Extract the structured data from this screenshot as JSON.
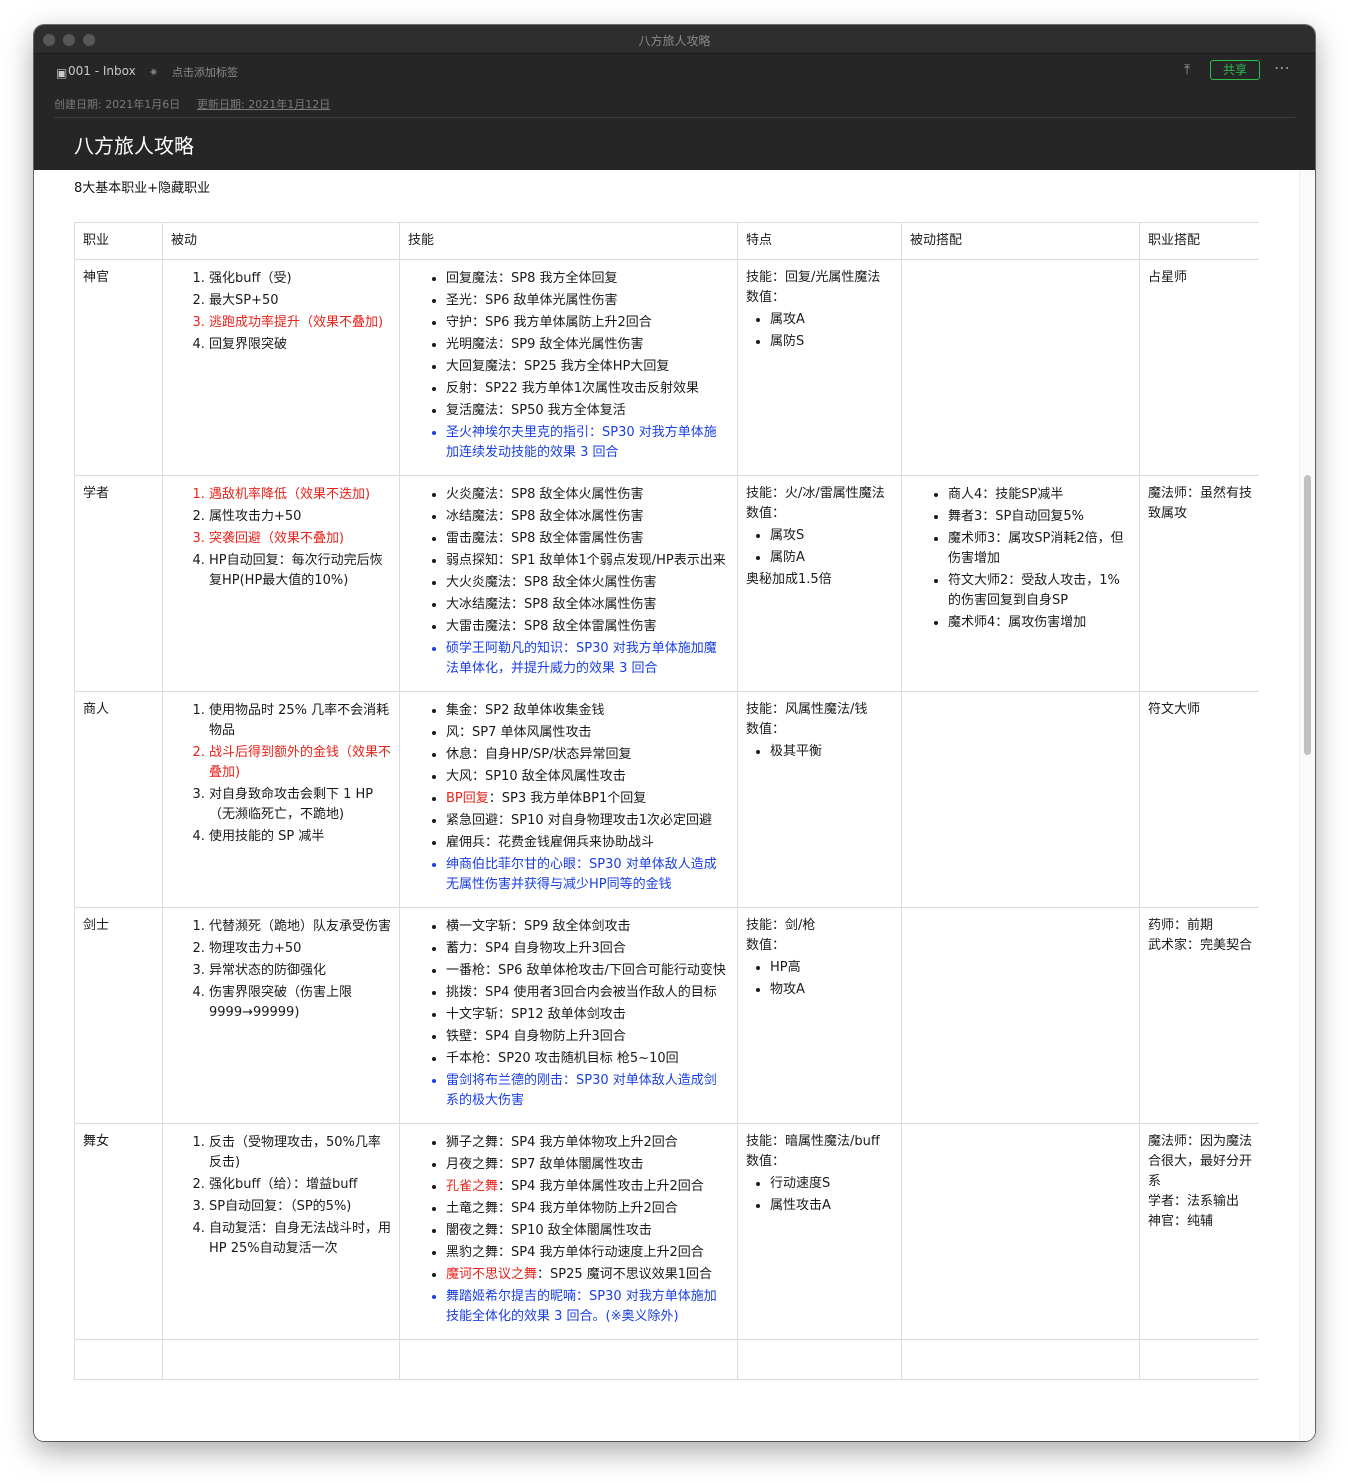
{
  "window": {
    "title": "八方旅人攻略"
  },
  "header": {
    "notebook": "001 - Inbox",
    "tag_placeholder": "点击添加标签",
    "share_label": "共享",
    "more_icon": "more-icon",
    "created": "创建日期: 2021年1月6日",
    "updated": "更新日期: 2021年1月12日"
  },
  "note": {
    "title": "八方旅人攻略",
    "subtitle": "8大基本职业+隐藏职业"
  },
  "colors": {
    "red": "#e8231b",
    "blue": "#1a3ee3",
    "share_green": "#2dbd4e"
  },
  "table": {
    "headers": [
      "职业",
      "被动",
      "技能",
      "特点",
      "被动搭配",
      "职业搭配"
    ],
    "rows": [
      {
        "job": "神官",
        "passives": [
          {
            "text": "强化buff（受)",
            "color": ""
          },
          {
            "text": "最大SP+50",
            "color": ""
          },
          {
            "text": "逃跑成功率提升（效果不叠加)",
            "color": "red"
          },
          {
            "text": "回复界限突破",
            "color": ""
          }
        ],
        "skills": [
          {
            "name": "回复魔法",
            "desc": "：SP8 我方全体回复",
            "color": ""
          },
          {
            "name": "圣光",
            "desc": "：SP6 敌单体光属性伤害",
            "color": ""
          },
          {
            "name": "守护",
            "desc": "：SP6 我方单体属防上升2回合",
            "color": ""
          },
          {
            "name": "光明魔法",
            "desc": "：SP9 敌全体光属性伤害",
            "color": ""
          },
          {
            "name": "大回复魔法",
            "desc": "：SP25 我方全体HP大回复",
            "color": ""
          },
          {
            "name": "反射",
            "desc": "：SP22 我方单体1次属性攻击反射效果",
            "color": ""
          },
          {
            "name": "复活魔法",
            "desc": "：SP50 我方全体复活",
            "color": ""
          },
          {
            "name": "圣火神埃尔夫里克的指引",
            "desc": "：SP30 对我方单体施加连续发动技能的效果 3 回合",
            "color": "blue"
          }
        ],
        "traits": {
          "lines": [
            "技能：回复/光属性魔法",
            "数值："
          ],
          "subs": [
            "属攻A",
            "属防S"
          ],
          "after": []
        },
        "passive_combos": [],
        "job_combos": [
          "占星师"
        ]
      },
      {
        "job": "学者",
        "passives": [
          {
            "text": "遇敌机率降低（效果不迭加)",
            "color": "red"
          },
          {
            "text": "属性攻击力+50",
            "color": ""
          },
          {
            "text": "突袭回避（效果不叠加)",
            "color": "red"
          },
          {
            "text": "HP自动回复：每次行动完后恢复HP(HP最大值的10%)",
            "color": ""
          }
        ],
        "skills": [
          {
            "name": "火炎魔法",
            "desc": "：SP8 敌全体火属性伤害",
            "color": ""
          },
          {
            "name": "冰结魔法",
            "desc": "：SP8 敌全体冰属性伤害",
            "color": ""
          },
          {
            "name": "雷击魔法",
            "desc": "：SP8 敌全体雷属性伤害",
            "color": ""
          },
          {
            "name": "弱点探知",
            "desc": "：SP1 敌单体1个弱点发现/HP表示出来",
            "color": ""
          },
          {
            "name": "大火炎魔法",
            "desc": "：SP8 敌全体火属性伤害",
            "color": ""
          },
          {
            "name": "大冰结魔法",
            "desc": "：SP8 敌全体冰属性伤害",
            "color": ""
          },
          {
            "name": "大雷击魔法",
            "desc": "：SP8 敌全体雷属性伤害",
            "color": ""
          },
          {
            "name": "硕学王阿勒凡的知识",
            "desc": "：SP30 对我方单体施加魔法单体化，并提升威力的效果 3 回合",
            "color": "blue"
          }
        ],
        "traits": {
          "lines": [
            "技能：火/冰/雷属性魔法",
            "数值："
          ],
          "subs": [
            "属攻S",
            "属防A"
          ],
          "after": [
            "奥秘加成1.5倍"
          ]
        },
        "passive_combos": [
          "商人4：技能SP减半",
          "舞者3：SP自动回复5%",
          "魔术师3：属攻SP消耗2倍，但伤害增加",
          "符文大师2：受敌人攻击，1%的伤害回复到自身SP",
          "魔术师4：属攻伤害增加"
        ],
        "job_combos": [
          "魔法师：虽然有技致属攻"
        ]
      },
      {
        "job": "商人",
        "passives": [
          {
            "text": "使用物品时 25% 几率不会消耗物品",
            "color": ""
          },
          {
            "text": "战斗后得到额外的金钱（效果不叠加)",
            "color": "red"
          },
          {
            "text": "对自身致命攻击会剩下 1 HP （无濒临死亡，不跪地)",
            "color": ""
          },
          {
            "text": "使用技能的 SP 减半",
            "color": ""
          }
        ],
        "skills": [
          {
            "name": "集金",
            "desc": "：SP2 敌单体收集金钱",
            "color": ""
          },
          {
            "name": "风",
            "desc": "：SP7 单体风属性攻击",
            "color": ""
          },
          {
            "name": "休息",
            "desc": "：自身HP/SP/状态异常回复",
            "color": ""
          },
          {
            "name": "大风",
            "desc": "：SP10 敌全体风属性攻击",
            "color": ""
          },
          {
            "name": "BP回复",
            "desc": "：SP3 我方单体BP1个回复",
            "color": "red-name"
          },
          {
            "name": "紧急回避",
            "desc": "：SP10 对自身物理攻击1次必定回避",
            "color": ""
          },
          {
            "name": "雇佣兵",
            "desc": "：花费金钱雇佣兵来协助战斗",
            "color": ""
          },
          {
            "name": "绅商伯比菲尔甘的心眼",
            "desc": "：SP30 对单体敌人造成无属性伤害并获得与减少HP同等的金钱",
            "color": "blue"
          }
        ],
        "traits": {
          "lines": [
            "技能：风属性魔法/钱",
            "数值："
          ],
          "subs": [
            "极其平衡"
          ],
          "after": []
        },
        "passive_combos": [],
        "job_combos": [
          "符文大师"
        ]
      },
      {
        "job": "剑士",
        "passives": [
          {
            "text": "代替濒死（跪地）队友承受伤害",
            "color": ""
          },
          {
            "text": "物理攻击力+50",
            "color": ""
          },
          {
            "text": "异常状态的防御强化",
            "color": ""
          },
          {
            "text": "伤害界限突破（伤害上限9999→99999)",
            "color": ""
          }
        ],
        "skills": [
          {
            "name": "横一文字斩",
            "desc": "：SP9 敌全体剑攻击",
            "color": ""
          },
          {
            "name": "蓄力",
            "desc": "：SP4 自身物攻上升3回合",
            "color": ""
          },
          {
            "name": "一番枪",
            "desc": "：SP6 敌单体枪攻击/下回合可能行动变快",
            "color": ""
          },
          {
            "name": "挑拨",
            "desc": "：SP4 使用者3回合内会被当作敌人的目标",
            "color": ""
          },
          {
            "name": "十文字斩",
            "desc": "：SP12 敌单体剑攻击",
            "color": ""
          },
          {
            "name": "铁壁",
            "desc": "：SP4 自身物防上升3回合",
            "color": ""
          },
          {
            "name": "千本枪",
            "desc": "：SP20 攻击随机目标 枪5~10回",
            "color": ""
          },
          {
            "name": "雷剑将布兰德的刚击",
            "desc": "：SP30 对单体敌人造成剑系的极大伤害",
            "color": "blue"
          }
        ],
        "traits": {
          "lines": [
            "技能：剑/枪",
            "数值："
          ],
          "subs": [
            "HP高",
            "物攻A"
          ],
          "after": []
        },
        "passive_combos": [],
        "job_combos": [
          "药师：前期",
          "武术家：完美契合"
        ]
      },
      {
        "job": "舞女",
        "passives": [
          {
            "text": "反击（受物理攻击，50%几率反击)",
            "color": ""
          },
          {
            "text": "强化buff（给）：增益buff",
            "color": ""
          },
          {
            "text": "SP自动回复：（SP的5%)",
            "color": ""
          },
          {
            "text": "自动复活：自身无法战斗时，用HP 25%自动复活一次",
            "color": ""
          }
        ],
        "skills": [
          {
            "name": "狮子之舞",
            "desc": "：SP4 我方单体物攻上升2回合",
            "color": ""
          },
          {
            "name": "月夜之舞",
            "desc": "：SP7 敌单体闇属性攻击",
            "color": ""
          },
          {
            "name": "孔雀之舞",
            "desc": "：SP4 我方单体属性攻击上升2回合",
            "color": "red-name"
          },
          {
            "name": "土竜之舞",
            "desc": "：SP4 我方单体物防上升2回合",
            "color": ""
          },
          {
            "name": "闇夜之舞",
            "desc": "：SP10 敌全体闇属性攻击",
            "color": ""
          },
          {
            "name": "黑豹之舞",
            "desc": "：SP4 我方单体行动速度上升2回合",
            "color": ""
          },
          {
            "name": "魔诃不思议之舞",
            "desc": "：SP25 魔诃不思议效果1回合",
            "color": "red-name"
          },
          {
            "name": "舞踏姬希尔提吉的昵喃",
            "desc": "：SP30 对我方单体施加技能全体化的效果 3 回合。(※奥义除外)",
            "color": "blue"
          }
        ],
        "traits": {
          "lines": [
            "技能：暗属性魔法/buff",
            "数值："
          ],
          "subs": [
            "行动速度S",
            "属性攻击A"
          ],
          "after": []
        },
        "passive_combos": [],
        "job_combos": [
          "魔法师：因为魔法合很大，最好分开系",
          "学者：法系输出",
          "神官：纯辅"
        ]
      }
    ]
  }
}
